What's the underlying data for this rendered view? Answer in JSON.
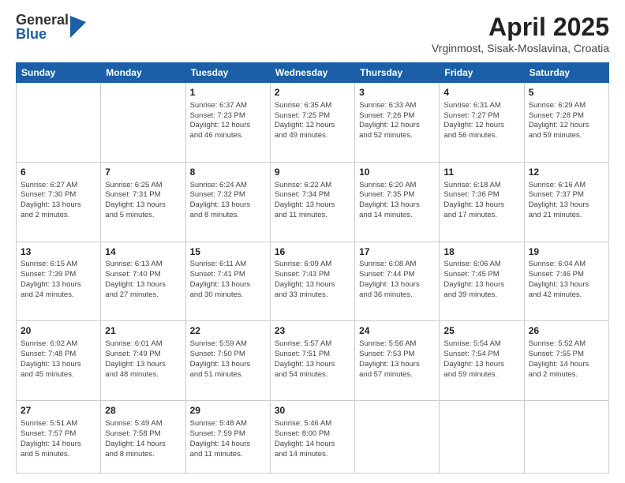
{
  "logo": {
    "general": "General",
    "blue": "Blue"
  },
  "title": "April 2025",
  "subtitle": "Vrginmost, Sisak-Moslavina, Croatia",
  "weekdays": [
    "Sunday",
    "Monday",
    "Tuesday",
    "Wednesday",
    "Thursday",
    "Friday",
    "Saturday"
  ],
  "weeks": [
    [
      {
        "day": "",
        "info": ""
      },
      {
        "day": "",
        "info": ""
      },
      {
        "day": "1",
        "info": "Sunrise: 6:37 AM\nSunset: 7:23 PM\nDaylight: 12 hours\nand 46 minutes."
      },
      {
        "day": "2",
        "info": "Sunrise: 6:35 AM\nSunset: 7:25 PM\nDaylight: 12 hours\nand 49 minutes."
      },
      {
        "day": "3",
        "info": "Sunrise: 6:33 AM\nSunset: 7:26 PM\nDaylight: 12 hours\nand 52 minutes."
      },
      {
        "day": "4",
        "info": "Sunrise: 6:31 AM\nSunset: 7:27 PM\nDaylight: 12 hours\nand 56 minutes."
      },
      {
        "day": "5",
        "info": "Sunrise: 6:29 AM\nSunset: 7:28 PM\nDaylight: 12 hours\nand 59 minutes."
      }
    ],
    [
      {
        "day": "6",
        "info": "Sunrise: 6:27 AM\nSunset: 7:30 PM\nDaylight: 13 hours\nand 2 minutes."
      },
      {
        "day": "7",
        "info": "Sunrise: 6:25 AM\nSunset: 7:31 PM\nDaylight: 13 hours\nand 5 minutes."
      },
      {
        "day": "8",
        "info": "Sunrise: 6:24 AM\nSunset: 7:32 PM\nDaylight: 13 hours\nand 8 minutes."
      },
      {
        "day": "9",
        "info": "Sunrise: 6:22 AM\nSunset: 7:34 PM\nDaylight: 13 hours\nand 11 minutes."
      },
      {
        "day": "10",
        "info": "Sunrise: 6:20 AM\nSunset: 7:35 PM\nDaylight: 13 hours\nand 14 minutes."
      },
      {
        "day": "11",
        "info": "Sunrise: 6:18 AM\nSunset: 7:36 PM\nDaylight: 13 hours\nand 17 minutes."
      },
      {
        "day": "12",
        "info": "Sunrise: 6:16 AM\nSunset: 7:37 PM\nDaylight: 13 hours\nand 21 minutes."
      }
    ],
    [
      {
        "day": "13",
        "info": "Sunrise: 6:15 AM\nSunset: 7:39 PM\nDaylight: 13 hours\nand 24 minutes."
      },
      {
        "day": "14",
        "info": "Sunrise: 6:13 AM\nSunset: 7:40 PM\nDaylight: 13 hours\nand 27 minutes."
      },
      {
        "day": "15",
        "info": "Sunrise: 6:11 AM\nSunset: 7:41 PM\nDaylight: 13 hours\nand 30 minutes."
      },
      {
        "day": "16",
        "info": "Sunrise: 6:09 AM\nSunset: 7:43 PM\nDaylight: 13 hours\nand 33 minutes."
      },
      {
        "day": "17",
        "info": "Sunrise: 6:08 AM\nSunset: 7:44 PM\nDaylight: 13 hours\nand 36 minutes."
      },
      {
        "day": "18",
        "info": "Sunrise: 6:06 AM\nSunset: 7:45 PM\nDaylight: 13 hours\nand 39 minutes."
      },
      {
        "day": "19",
        "info": "Sunrise: 6:04 AM\nSunset: 7:46 PM\nDaylight: 13 hours\nand 42 minutes."
      }
    ],
    [
      {
        "day": "20",
        "info": "Sunrise: 6:02 AM\nSunset: 7:48 PM\nDaylight: 13 hours\nand 45 minutes."
      },
      {
        "day": "21",
        "info": "Sunrise: 6:01 AM\nSunset: 7:49 PM\nDaylight: 13 hours\nand 48 minutes."
      },
      {
        "day": "22",
        "info": "Sunrise: 5:59 AM\nSunset: 7:50 PM\nDaylight: 13 hours\nand 51 minutes."
      },
      {
        "day": "23",
        "info": "Sunrise: 5:57 AM\nSunset: 7:51 PM\nDaylight: 13 hours\nand 54 minutes."
      },
      {
        "day": "24",
        "info": "Sunrise: 5:56 AM\nSunset: 7:53 PM\nDaylight: 13 hours\nand 57 minutes."
      },
      {
        "day": "25",
        "info": "Sunrise: 5:54 AM\nSunset: 7:54 PM\nDaylight: 13 hours\nand 59 minutes."
      },
      {
        "day": "26",
        "info": "Sunrise: 5:52 AM\nSunset: 7:55 PM\nDaylight: 14 hours\nand 2 minutes."
      }
    ],
    [
      {
        "day": "27",
        "info": "Sunrise: 5:51 AM\nSunset: 7:57 PM\nDaylight: 14 hours\nand 5 minutes."
      },
      {
        "day": "28",
        "info": "Sunrise: 5:49 AM\nSunset: 7:58 PM\nDaylight: 14 hours\nand 8 minutes."
      },
      {
        "day": "29",
        "info": "Sunrise: 5:48 AM\nSunset: 7:59 PM\nDaylight: 14 hours\nand 11 minutes."
      },
      {
        "day": "30",
        "info": "Sunrise: 5:46 AM\nSunset: 8:00 PM\nDaylight: 14 hours\nand 14 minutes."
      },
      {
        "day": "",
        "info": ""
      },
      {
        "day": "",
        "info": ""
      },
      {
        "day": "",
        "info": ""
      }
    ]
  ]
}
